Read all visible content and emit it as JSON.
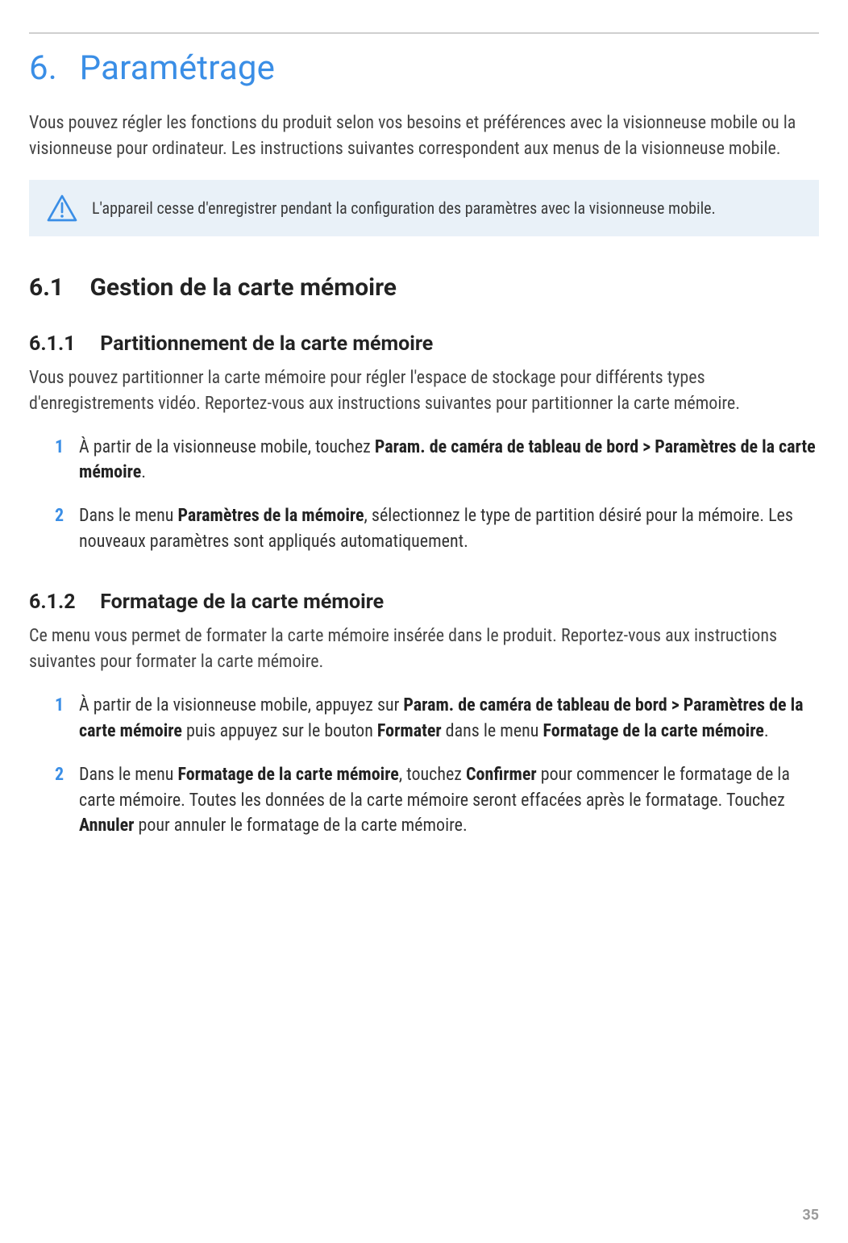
{
  "chapter": {
    "number": "6.",
    "title": "Paramétrage"
  },
  "intro": "Vous pouvez régler les fonctions du produit selon vos besoins et préférences avec la visionneuse mobile ou la visionneuse pour ordinateur. Les instructions suivantes correspondent aux menus de la visionneuse mobile.",
  "caution": {
    "icon_name": "caution-triangle-icon",
    "text": "L'appareil cesse d'enregistrer pendant la configuration des paramètres avec la visionneuse mobile."
  },
  "section_6_1": {
    "number": "6.1",
    "title": "Gestion de la carte mémoire"
  },
  "section_6_1_1": {
    "number": "6.1.1",
    "title": "Partitionnement de la carte mémoire",
    "para": "Vous pouvez partitionner la carte mémoire pour régler l'espace de stockage pour différents types d'enregistrements vidéo. Reportez-vous aux instructions suivantes pour partitionner la carte mémoire.",
    "steps": [
      {
        "num": "1",
        "pre": "À partir de la visionneuse mobile, touchez ",
        "b1": "Param. de caméra de tableau de bord",
        "gt": " > ",
        "b2": "Paramètres de la carte mémoire",
        "post": "."
      },
      {
        "num": "2",
        "pre": "Dans le menu ",
        "b1": "Paramètres de la mémoire",
        "post": ", sélectionnez le type de partition désiré pour la mémoire. Les nouveaux paramètres sont appliqués automatiquement."
      }
    ]
  },
  "section_6_1_2": {
    "number": "6.1.2",
    "title": "Formatage de la carte mémoire",
    "para": "Ce menu vous permet de formater la carte mémoire insérée dans le produit. Reportez-vous aux instructions suivantes pour formater la carte mémoire.",
    "steps": [
      {
        "num": "1",
        "pre": "À partir de la visionneuse mobile, appuyez sur ",
        "b1": "Param. de caméra de tableau de bord",
        "gt": " > ",
        "b2": "Paramètres de la carte mémoire",
        "mid": " puis appuyez sur le bouton ",
        "b3": "Formater",
        "mid2": " dans le menu ",
        "b4": "Formatage de la carte mémoire",
        "post": "."
      },
      {
        "num": "2",
        "pre": "Dans le menu ",
        "b1": "Formatage de la carte mémoire",
        "mid": ", touchez ",
        "b2": "Confirmer",
        "mid2": " pour commencer le formatage de la carte mémoire. Toutes les données de la carte mémoire seront effacées après le formatage. Touchez ",
        "b3": "Annuler",
        "post": " pour annuler le formatage de la carte mémoire."
      }
    ]
  },
  "page_number": "35"
}
